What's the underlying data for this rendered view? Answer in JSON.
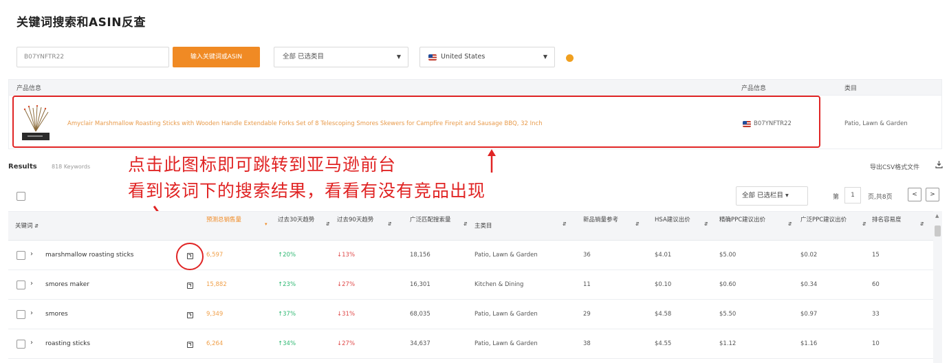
{
  "title": "关键词搜索和ASIN反查",
  "search": {
    "value": "B07YNFTR22",
    "button_label": "输入关键词或ASIN",
    "category_select": "全部 已选类目",
    "country_select": "United States"
  },
  "product_table": {
    "headers": [
      "产品信息",
      "产品信息",
      "类目"
    ],
    "product_title": "Amyclair Marshmallow Roasting Sticks with Wooden Handle Extendable Forks Set of 8 Telescoping Smores Skewers for Campfire Firepit and Sausage BBQ, 32 Inch",
    "asin": "B07YNFTR22",
    "category": "Patio, Lawn & Garden"
  },
  "results": {
    "label": "Results",
    "count": "818 Keywords",
    "export_label": "导出CSV格式文件"
  },
  "annotations": {
    "line1": "点击此图标即可跳转到亚马逊前台",
    "line2": "看到该词下的搜索结果，看看有没有竞品出现"
  },
  "toolbar": {
    "filter_select": "全部 已选栏目",
    "page_prefix": "第",
    "page_number": "1",
    "page_suffix": "页,共8页",
    "prev": "<",
    "next": ">"
  },
  "table": {
    "headers": [
      "关键词",
      "预测总销售量",
      "过去30天趋势",
      "过去90天趋势",
      "广泛匹配搜索量",
      "主类目",
      "新品销量参考",
      "HSA建议出价",
      "精确PPC建议出价",
      "广泛PPC建议出价",
      "排名容易度"
    ],
    "rows": [
      {
        "keyword": "marshmallow roasting sticks",
        "sales": "6,597",
        "trend30": "↑20%",
        "trend90": "↓13%",
        "volume": "18,156",
        "category": "Patio, Lawn & Garden",
        "newsales": "36",
        "hsa": "$4.01",
        "exact": "$5.00",
        "broad": "$0.02",
        "ease": "15"
      },
      {
        "keyword": "smores maker",
        "sales": "15,882",
        "trend30": "↑23%",
        "trend90": "↓27%",
        "volume": "16,301",
        "category": "Kitchen & Dining",
        "newsales": "11",
        "hsa": "$0.10",
        "exact": "$0.60",
        "broad": "$0.34",
        "ease": "60"
      },
      {
        "keyword": "smores",
        "sales": "9,349",
        "trend30": "↑37%",
        "trend90": "↓31%",
        "volume": "68,035",
        "category": "Patio, Lawn & Garden",
        "newsales": "29",
        "hsa": "$4.58",
        "exact": "$5.50",
        "broad": "$0.97",
        "ease": "33"
      },
      {
        "keyword": "roasting sticks",
        "sales": "6,264",
        "trend30": "↑34%",
        "trend90": "↓27%",
        "volume": "34,637",
        "category": "Patio, Lawn & Garden",
        "newsales": "38",
        "hsa": "$4.55",
        "exact": "$1.12",
        "broad": "$1.16",
        "ease": "10"
      }
    ]
  }
}
